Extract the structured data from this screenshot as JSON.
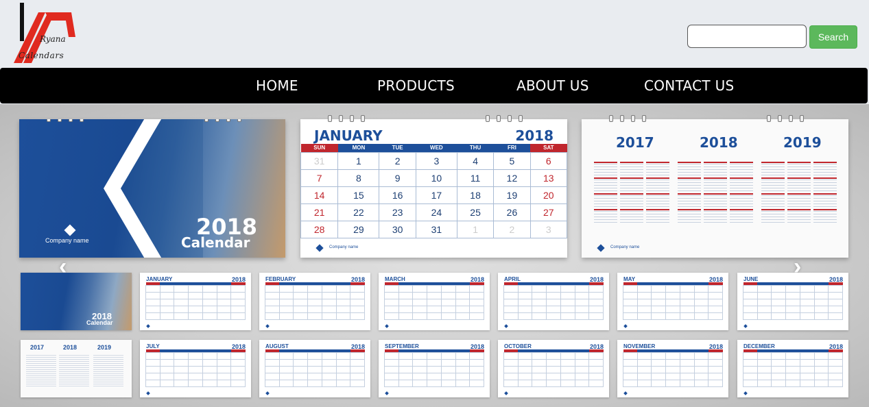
{
  "brand": {
    "logo_line1": "Ryana",
    "logo_line2": "Calendars"
  },
  "search": {
    "placeholder": "",
    "button_label": "Search"
  },
  "nav": {
    "items": [
      {
        "label": "HOME"
      },
      {
        "label": "PRODUCTS"
      },
      {
        "label": "ABOUT US"
      },
      {
        "label": "CONTACT US"
      }
    ]
  },
  "colors": {
    "brand_red": "#e02a1f",
    "calendar_blue": "#1d4f9a",
    "calendar_red": "#c0262d",
    "search_green": "#5cb85c",
    "nav_bg": "#000000"
  },
  "slider": {
    "prev_icon": "chevron-left-icon",
    "next_icon": "chevron-right-icon",
    "cover": {
      "year": "2018",
      "title": "Calendar",
      "company": "Company name"
    },
    "january": {
      "month": "JANUARY",
      "year": "2018",
      "weekdays": [
        "SUN",
        "MON",
        "TUE",
        "WED",
        "THU",
        "FRI",
        "SAT"
      ],
      "weeks": [
        [
          "31",
          "1",
          "2",
          "3",
          "4",
          "5",
          "6"
        ],
        [
          "7",
          "8",
          "9",
          "10",
          "11",
          "12",
          "13"
        ],
        [
          "14",
          "15",
          "16",
          "17",
          "18",
          "19",
          "20"
        ],
        [
          "21",
          "22",
          "23",
          "24",
          "25",
          "26",
          "27"
        ],
        [
          "28",
          "29",
          "30",
          "31",
          "1",
          "2",
          "3"
        ]
      ],
      "company": "Company name"
    },
    "overview": {
      "years": [
        "2017",
        "2018",
        "2019"
      ],
      "company": "Company name"
    }
  },
  "thumbnails": {
    "row1": [
      {
        "kind": "cover",
        "year": "2018",
        "title": "Calendar"
      },
      {
        "kind": "month",
        "month": "JANUARY",
        "year": "2018"
      },
      {
        "kind": "month",
        "month": "FEBRUARY",
        "year": "2018"
      },
      {
        "kind": "month",
        "month": "MARCH",
        "year": "2018"
      },
      {
        "kind": "month",
        "month": "APRIL",
        "year": "2018"
      },
      {
        "kind": "month",
        "month": "MAY",
        "year": "2018"
      },
      {
        "kind": "month",
        "month": "JUNE",
        "year": "2018"
      }
    ],
    "row2": [
      {
        "kind": "years",
        "years": [
          "2017",
          "2018",
          "2019"
        ]
      },
      {
        "kind": "month",
        "month": "JULY",
        "year": "2018"
      },
      {
        "kind": "month",
        "month": "AUGUST",
        "year": "2018"
      },
      {
        "kind": "month",
        "month": "SEPTEMBER",
        "year": "2018"
      },
      {
        "kind": "month",
        "month": "OCTOBER",
        "year": "2018"
      },
      {
        "kind": "month",
        "month": "NOVEMBER",
        "year": "2018"
      },
      {
        "kind": "month",
        "month": "DECEMBER",
        "year": "2018"
      }
    ]
  }
}
